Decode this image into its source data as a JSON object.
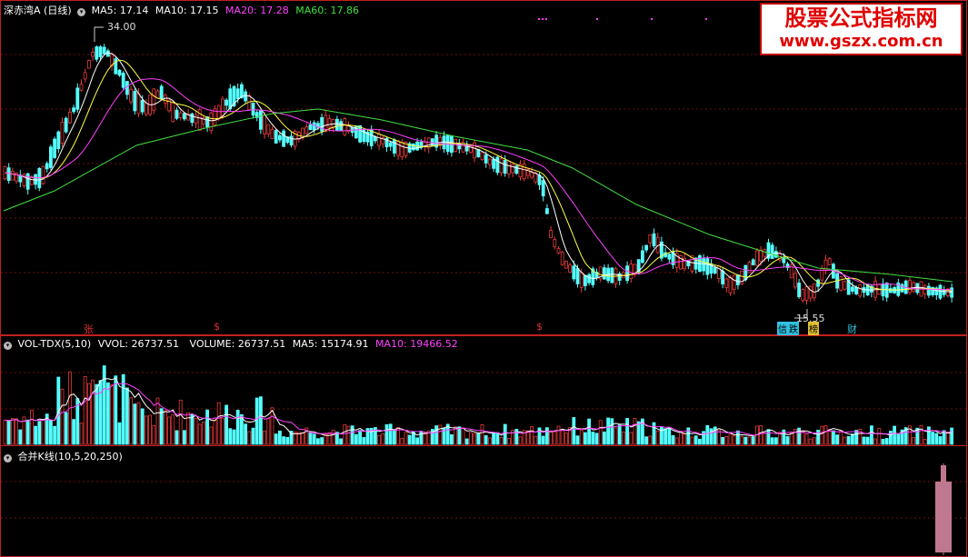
{
  "main_header": {
    "stock_name": "深赤湾A (日线)",
    "ma5": "MA5: 17.14",
    "ma10": "MA10: 17.15",
    "ma20": "MA20: 17.28",
    "ma60": "MA60: 17.86"
  },
  "watermark": {
    "line1": "股票公式指标网",
    "line2": "www.gszx.com.cn"
  },
  "price_annotations": {
    "high": "34.00",
    "low": "15.55"
  },
  "event_markers": [
    {
      "label": "张",
      "color": "#e03030"
    },
    {
      "label": "$",
      "color": "#e03030"
    },
    {
      "label": "$",
      "color": "#e03030"
    },
    {
      "label": "信",
      "color": "#30c0e0"
    },
    {
      "label": "跌",
      "color": "#30c0e0"
    },
    {
      "label": "榜",
      "color": "#e0c030"
    },
    {
      "label": "财",
      "color": "#30c0e0"
    }
  ],
  "volume_header": {
    "name": "VOL-TDX(5,10)",
    "vvol": "VVOL: 26737.51",
    "volume": "VOLUME: 26737.51",
    "ma5": "MA5: 15174.91",
    "ma10": "MA10: 19466.52"
  },
  "indicator_header": {
    "name": "合并K线(10,5,20,250)"
  },
  "colors": {
    "up": "#e83a3a",
    "down": "#54ffff",
    "ma5": "#ffffff",
    "ma10": "#ffff40",
    "ma20": "#ff40ff",
    "ma60": "#40e040",
    "border": "#c02020",
    "merged": "#c07890"
  }
}
